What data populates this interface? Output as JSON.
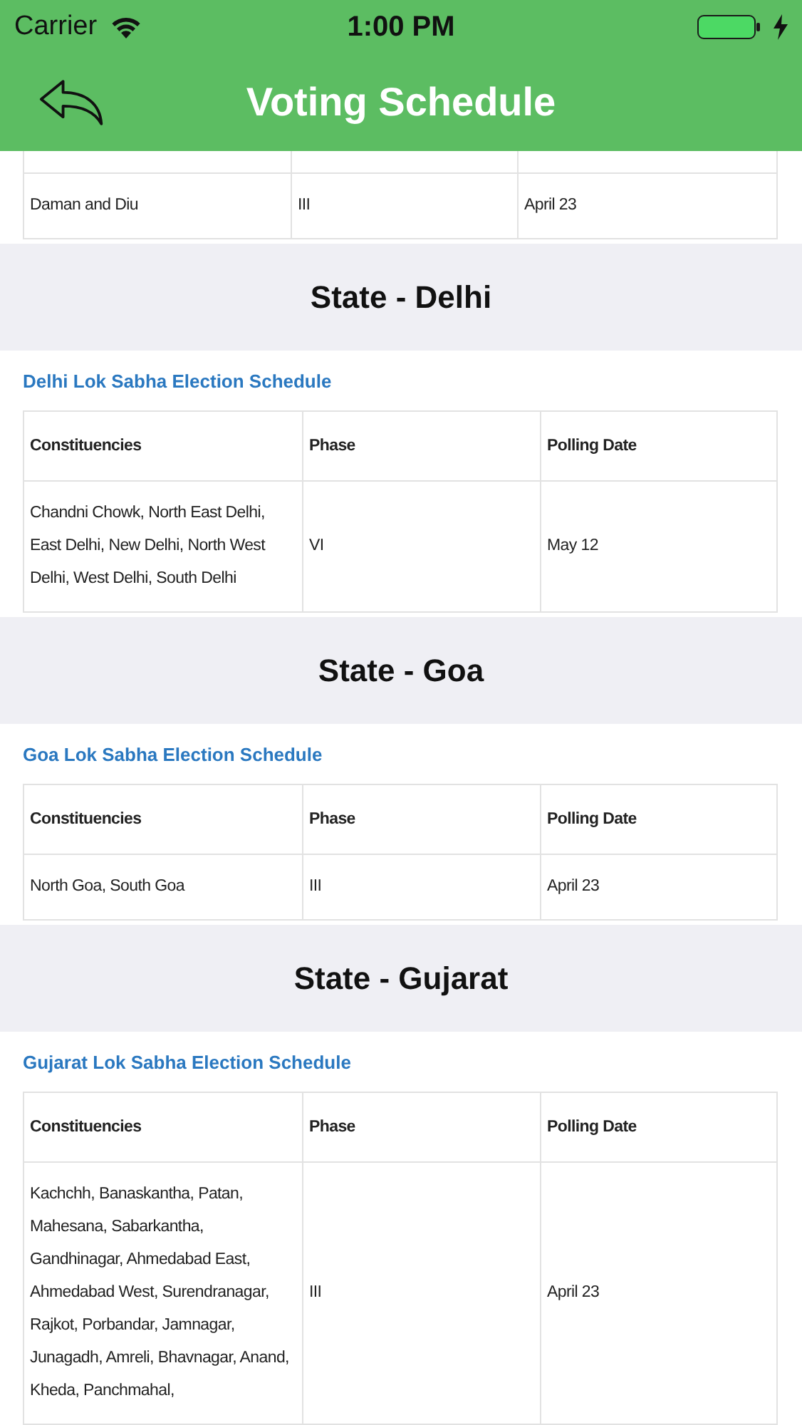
{
  "status_bar": {
    "carrier": "Carrier",
    "time": "1:00 PM"
  },
  "nav": {
    "title": "Voting Schedule"
  },
  "sections": [
    {
      "kind": "fragment",
      "rows": [
        [
          "Daman and Diu",
          "III",
          "April 23"
        ]
      ]
    },
    {
      "kind": "state",
      "title": "State - Delhi",
      "link": "Delhi Lok Sabha Election Schedule",
      "columns": [
        "Constituencies",
        "Phase",
        "Polling Date"
      ],
      "rows": [
        [
          "Chandni Chowk, North East Delhi, East Delhi, New Delhi, North West Delhi, West Delhi, South Delhi",
          "VI",
          "May 12"
        ]
      ]
    },
    {
      "kind": "state",
      "title": "State - Goa",
      "link": "Goa Lok Sabha Election Schedule",
      "columns": [
        "Constituencies",
        "Phase",
        "Polling Date"
      ],
      "rows": [
        [
          "North Goa, South Goa",
          "III",
          "April 23"
        ]
      ]
    },
    {
      "kind": "state",
      "title": "State - Gujarat",
      "link": "Gujarat Lok Sabha Election Schedule",
      "columns": [
        "Constituencies",
        "Phase",
        "Polling Date"
      ],
      "rows": [
        [
          "Kachchh, Banaskantha, Patan, Mahesana, Sabarkantha, Gandhinagar, Ahmedabad East, Ahmedabad West, Surendranagar, Rajkot, Porbandar, Jamnagar, Junagadh, Amreli, Bhavnagar, Anand, Kheda, Panchmahal,",
          "III",
          "April 23"
        ]
      ]
    }
  ]
}
